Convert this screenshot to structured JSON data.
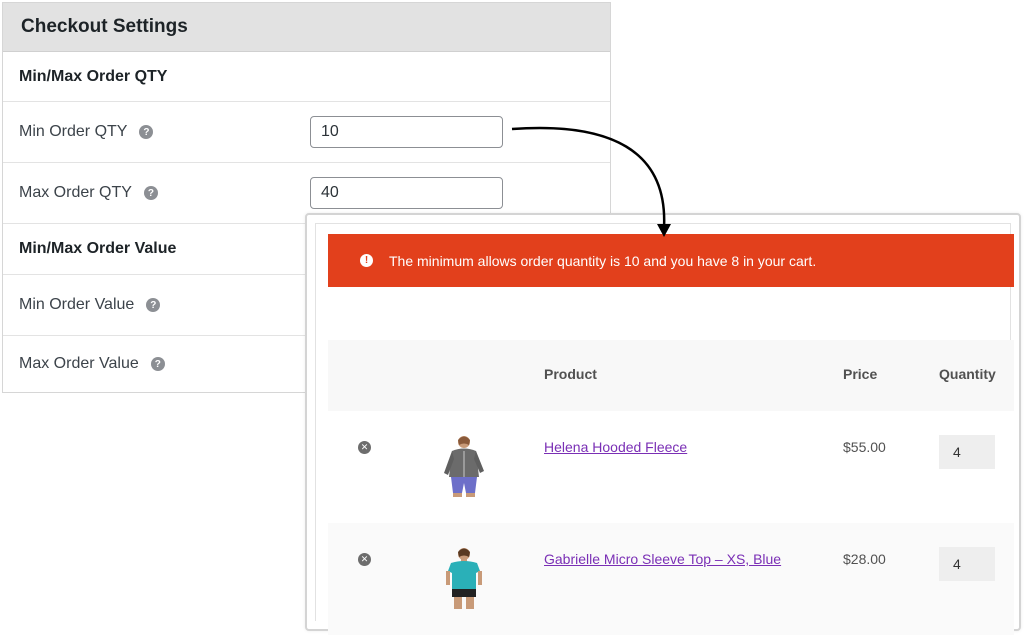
{
  "settings": {
    "title": "Checkout Settings",
    "qty_section": "Min/Max Order QTY",
    "min_qty_label": "Min Order QTY",
    "min_qty_value": "10",
    "max_qty_label": "Max Order QTY",
    "max_qty_value": "40",
    "value_section": "Min/Max Order Value",
    "min_value_label": "Min Order Value",
    "max_value_label": "Max Order Value",
    "help_glyph": "?"
  },
  "cart": {
    "notice": "The minimum allows order quantity is 10 and you have 8 in your cart.",
    "notice_icon": "!",
    "notice_color": "#e2401c",
    "columns": {
      "product": "Product",
      "price": "Price",
      "quantity": "Quantity"
    },
    "items": [
      {
        "name": "Helena Hooded Fleece",
        "price": "$55.00",
        "quantity": "4",
        "image_icon": "hoodie-product-image"
      },
      {
        "name": "Gabrielle Micro Sleeve Top – XS, Blue",
        "price": "$28.00",
        "quantity": "4",
        "image_icon": "top-product-image"
      }
    ],
    "remove_glyph": "✕",
    "link_color": "#7a2fb5"
  }
}
